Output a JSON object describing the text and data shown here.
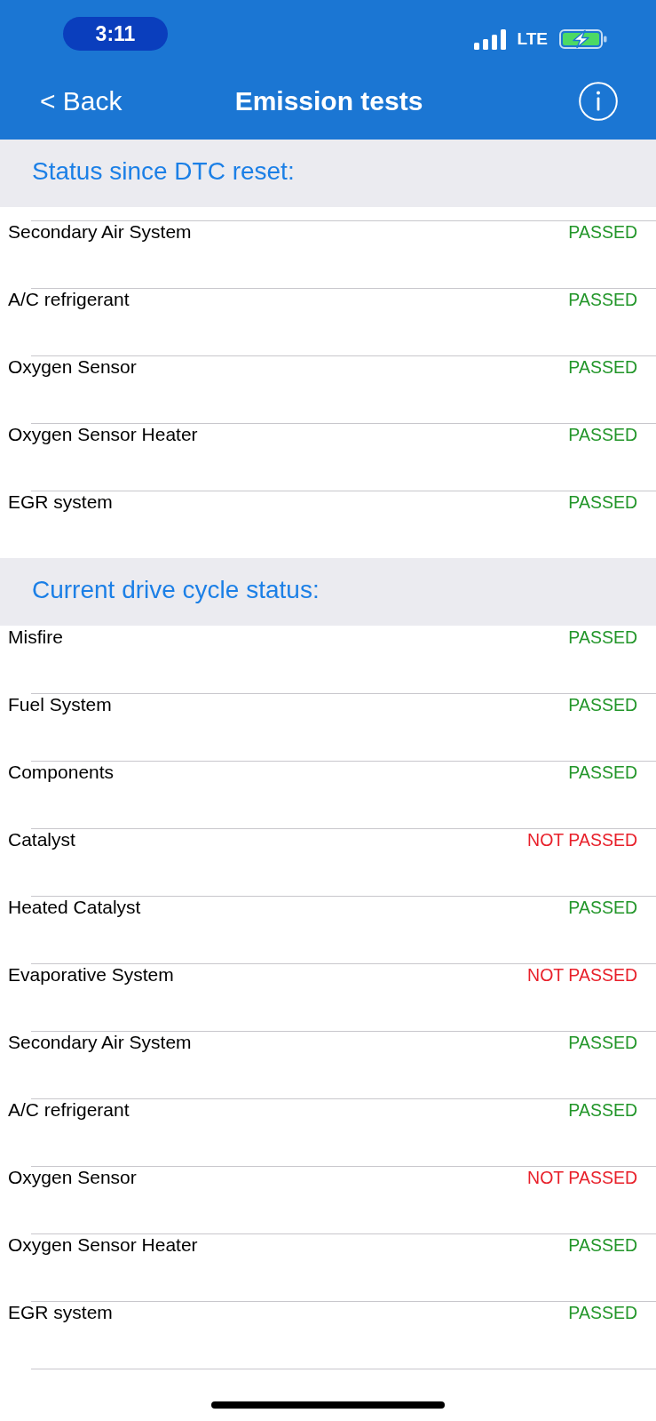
{
  "status_bar": {
    "time": "3:11",
    "network": "LTE"
  },
  "nav_bar": {
    "back": "< Back",
    "title": "Emission tests"
  },
  "sections": [
    {
      "title": "Status since DTC reset:",
      "rows": [
        {
          "label": "Secondary Air System",
          "status": "PASSED",
          "passed": true
        },
        {
          "label": "A/C refrigerant",
          "status": "PASSED",
          "passed": true
        },
        {
          "label": "Oxygen Sensor",
          "status": "PASSED",
          "passed": true
        },
        {
          "label": "Oxygen Sensor Heater",
          "status": "PASSED",
          "passed": true
        },
        {
          "label": "EGR system",
          "status": "PASSED",
          "passed": true
        }
      ]
    },
    {
      "title": "Current drive cycle status:",
      "rows": [
        {
          "label": "Misfire",
          "status": "PASSED",
          "passed": true
        },
        {
          "label": "Fuel System",
          "status": "PASSED",
          "passed": true
        },
        {
          "label": "Components",
          "status": "PASSED",
          "passed": true
        },
        {
          "label": "Catalyst",
          "status": "NOT PASSED",
          "passed": false
        },
        {
          "label": "Heated Catalyst",
          "status": "PASSED",
          "passed": true
        },
        {
          "label": "Evaporative System",
          "status": "NOT PASSED",
          "passed": false
        },
        {
          "label": "Secondary Air System",
          "status": "PASSED",
          "passed": true
        },
        {
          "label": "A/C refrigerant",
          "status": "PASSED",
          "passed": true
        },
        {
          "label": "Oxygen Sensor",
          "status": "NOT PASSED",
          "passed": false
        },
        {
          "label": "Oxygen Sensor Heater",
          "status": "PASSED",
          "passed": true
        },
        {
          "label": "EGR system",
          "status": "PASSED",
          "passed": true
        }
      ]
    }
  ]
}
